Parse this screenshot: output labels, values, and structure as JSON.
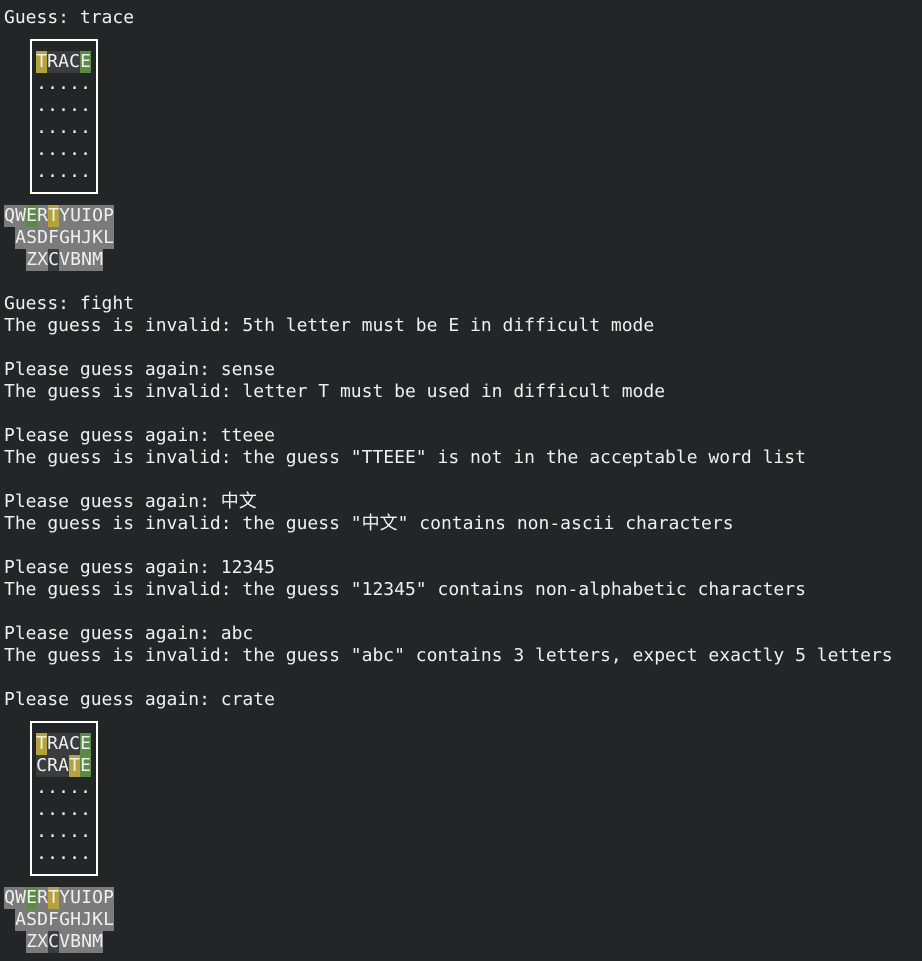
{
  "colors": {
    "background": "#232627",
    "text": "#f0f0f0",
    "correct": "#5b8a47",
    "present": "#b4a33c",
    "absent": "#7b7b7b",
    "unused": "#3a3d3e"
  },
  "lines": {
    "l1": "Guess: trace",
    "l2": "Guess: fight",
    "l3": "The guess is invalid: 5th letter must be E in difficult mode",
    "l4": "Please guess again: sense",
    "l5": "The guess is invalid: letter T must be used in difficult mode",
    "l6": "Please guess again: tteee",
    "l7": "The guess is invalid: the guess \"TTEEE\" is not in the acceptable word list",
    "l8": "Please guess again: 中文",
    "l9": "The guess is invalid: the guess \"中文\" contains non-ascii characters",
    "l10": "Please guess again: 12345",
    "l11": "The guess is invalid: the guess \"12345\" contains non-alphabetic characters",
    "l12": "Please guess again: abc",
    "l13": "The guess is invalid: the guess \"abc\" contains 3 letters, expect exactly 5 letters",
    "l14": "Please guess again: crate"
  },
  "boards": [
    {
      "rows": [
        {
          "text": "TRACE",
          "states": "yuuug"
        },
        {
          "text": ".....",
          "states": "....."
        },
        {
          "text": ".....",
          "states": "....."
        },
        {
          "text": ".....",
          "states": "....."
        },
        {
          "text": ".....",
          "states": "....."
        },
        {
          "text": ".....",
          "states": "....."
        }
      ]
    },
    {
      "rows": [
        {
          "text": "TRACE",
          "states": "yuuug"
        },
        {
          "text": "CRATE",
          "states": "uuuyg"
        },
        {
          "text": ".....",
          "states": "....."
        },
        {
          "text": ".....",
          "states": "....."
        },
        {
          "text": ".....",
          "states": "....."
        },
        {
          "text": ".....",
          "states": "....."
        }
      ]
    }
  ],
  "keyboards": [
    {
      "rows": [
        {
          "text": "QWERTYUIOP",
          "states": "xxgxyxxxxx"
        },
        {
          "text": "ASDFGHJKL",
          "states": "xxxxxxxxx"
        },
        {
          "text": "ZXCVBNM",
          "states": "xxuxxxx"
        }
      ]
    },
    {
      "rows": [
        {
          "text": "QWERTYUIOP",
          "states": "xxgxyxxxxx"
        },
        {
          "text": "ASDFGHJKL",
          "states": "xxxxxxxxx"
        },
        {
          "text": "ZXCVBNM",
          "states": "xxuxxxx"
        }
      ]
    }
  ]
}
